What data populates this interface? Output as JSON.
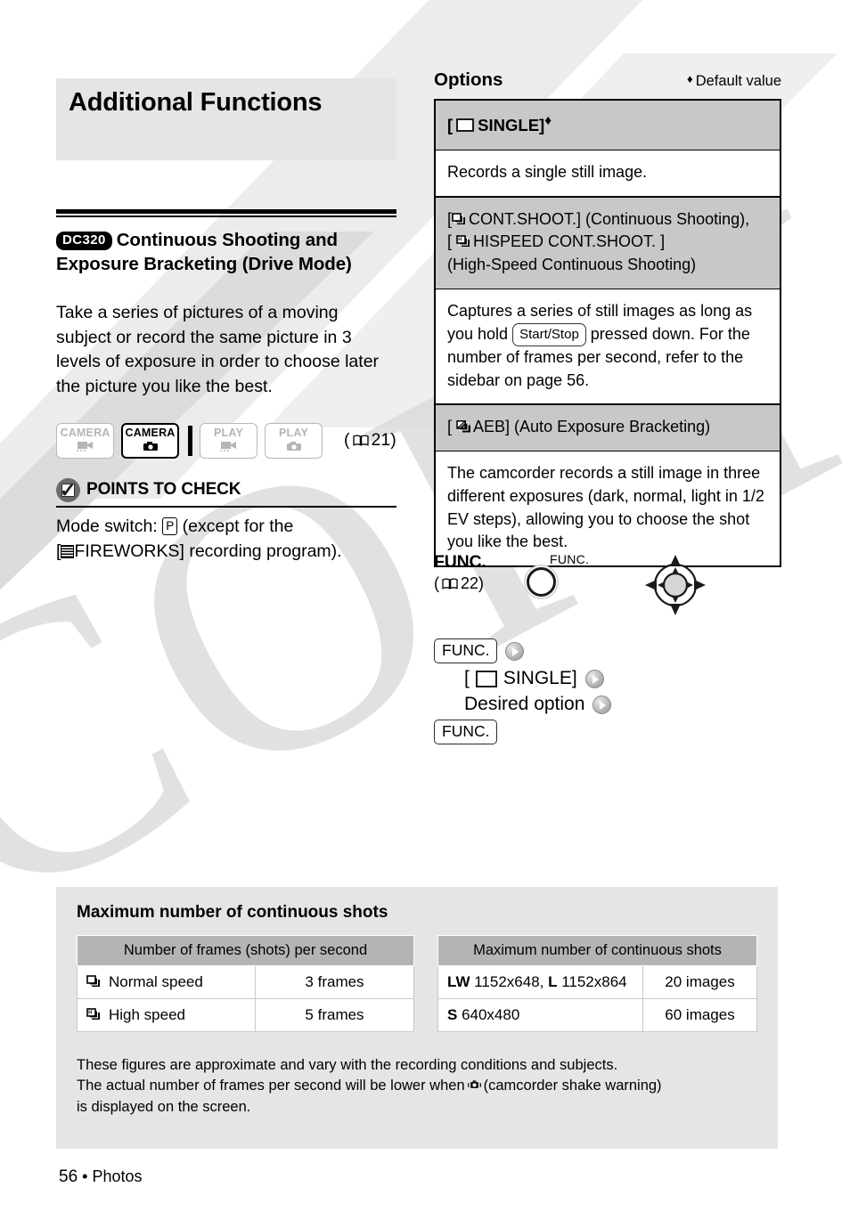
{
  "chapter": {
    "title": "Additional Functions"
  },
  "section": {
    "model_badge": "DC320",
    "heading_line1": "Continuous Shooting and",
    "heading_line2": "Exposure Bracketing (Drive Mode)",
    "intro": "Take a series of pictures of a moving subject or record the same picture in 3 levels of exposure in order to choose later the picture you like the best."
  },
  "modes": {
    "items": [
      {
        "label": "CAMERA",
        "glyph": "movie-camera-icon",
        "active": false
      },
      {
        "label": "CAMERA",
        "glyph": "still-camera-icon",
        "active": true
      },
      {
        "label": "PLAY",
        "glyph": "movie-camera-icon",
        "active": false
      },
      {
        "label": "PLAY",
        "glyph": "still-camera-icon",
        "active": false
      }
    ],
    "page_ref_open": "(",
    "page_ref_num": "21",
    "page_ref_close": ")"
  },
  "points_to_check": {
    "title": "POINTS TO CHECK",
    "line1_a": "Mode switch:",
    "key": "P",
    "line1_b": "(except for the",
    "line2_a": "[",
    "line2_b": "FIREWORKS] recording program)."
  },
  "options": {
    "title": "Options",
    "default_note": "Default value",
    "default_marker": "♦",
    "rows": [
      {
        "type": "name",
        "shade": true,
        "prefix": "[",
        "icon": "single-frame-icon",
        "label": "SINGLE]",
        "marker": "♦"
      },
      {
        "type": "desc",
        "shade": false,
        "text": "Records a single still image."
      },
      {
        "type": "name-multi",
        "shade": true,
        "line1_prefix": "[",
        "line1_icon": "continuous-shoot-icon",
        "line1_text": "CONT.SHOOT.] (Continuous Shooting),",
        "line2_prefix": "[",
        "line2_icon": "hispeed-continuous-shoot-icon",
        "line2_text": "HISPEED CONT.SHOOT. ]",
        "line3_text": "(High-Speed Continuous Shooting)"
      },
      {
        "type": "desc-key",
        "shade": false,
        "text_a": "Captures a series of still images as long as you hold",
        "keycap": "Start/Stop",
        "text_b": "pressed down. For the number of frames per second, refer to the sidebar on page 56."
      },
      {
        "type": "name-aeb",
        "shade": true,
        "prefix": "[",
        "icon": "aeb-icon",
        "label": "AEB] (Auto Exposure Bracketing)"
      },
      {
        "type": "desc",
        "shade": false,
        "text": "The camcorder records a still image in three different exposures (dark, normal, light in 1/2 EV steps), allowing you to choose the shot you like the best."
      }
    ]
  },
  "func_block": {
    "label": "FUNC.",
    "page_ref_open": "(",
    "page_ref_num": "22",
    "page_ref_close": ")",
    "dial_caption": "FUNC.",
    "steps": [
      {
        "kind": "key",
        "text": "FUNC.",
        "has_button": true
      },
      {
        "kind": "text-bracket",
        "prefix": "[",
        "icon": "single-frame-icon",
        "text": "SINGLE]",
        "has_button": true
      },
      {
        "kind": "text",
        "text": "Desired option",
        "has_button": true
      },
      {
        "kind": "key",
        "text": "FUNC.",
        "has_button": false
      }
    ]
  },
  "sidebar": {
    "title": "Maximum number of continuous shots",
    "table_left": {
      "header": "Number of frames (shots) per second",
      "rows": [
        {
          "icon": "continuous-shoot-icon",
          "label": "Normal speed",
          "value": "3 frames"
        },
        {
          "icon": "hispeed-continuous-shoot-icon",
          "label": "High speed",
          "value": "5 frames"
        }
      ]
    },
    "table_right": {
      "header": "Maximum number of continuous shots",
      "rows": [
        {
          "label_bold1": "LW",
          "label_rest1": " 1152x648, ",
          "label_bold2": "L",
          "label_rest2": " 1152x864",
          "value": "20 images"
        },
        {
          "label_bold1": "S",
          "label_rest1": " 640x480",
          "label_bold2": "",
          "label_rest2": "",
          "value": "60 images"
        }
      ]
    },
    "note_line1": "These figures are approximate and vary with the recording conditions and subjects.",
    "note_line2_a": "The actual number of frames per second will be lower when",
    "note_line2_b": "(camcorder shake warning)",
    "note_line3": "is displayed on the screen."
  },
  "footer": {
    "page": "56",
    "bullet": "•",
    "section": "Photos"
  },
  "watermark": {
    "text": "COPY"
  },
  "colors": {
    "band": "#e5e5e5",
    "shade": "#c8c8c8",
    "table_header": "#b4b4b4",
    "ink": "#000000"
  }
}
